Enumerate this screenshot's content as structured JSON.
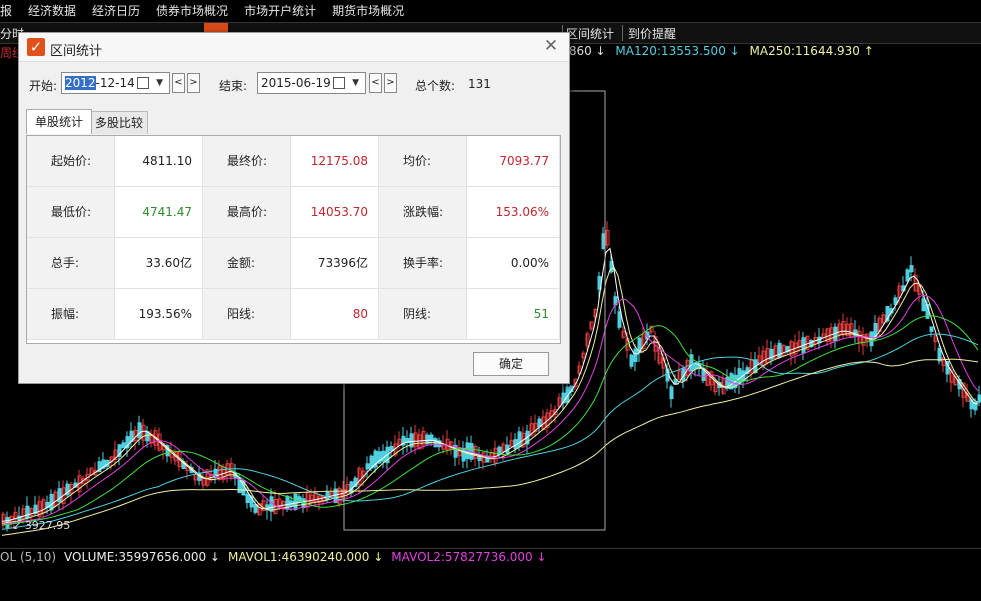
{
  "menubar": [
    "报",
    "经济数据",
    "经济日历",
    "债券市场概况",
    "市场开户统计",
    "期货市场概况"
  ],
  "tabstrip": {
    "left": "分时",
    "middle": "区间统计",
    "right": "到价提醒"
  },
  "side_label": "周线",
  "ma_line": {
    "ma_prefix": ".860 ↓",
    "ma120": "MA120:13553.500 ↓",
    "ma250": "MA250:11644.930 ↑"
  },
  "chart_low_label": "3927.95",
  "volume_line": {
    "prefix": "OL (5,10)",
    "volume": "VOLUME:35997656.000 ↓",
    "mavol1": "MAVOL1:46390240.000 ↓",
    "mavol2": "MAVOL2:57827736.000 ↓"
  },
  "colors": {
    "up": "#e03c3c",
    "down": "#4fd0e0",
    "ma120": "#4fd0e0",
    "ma250": "#f0f0a0",
    "mavol1": "#f0f0a0",
    "mavol2": "#e040e0",
    "dialog_red": "#c0262c",
    "dialog_green": "#2e8b2e",
    "accent": "#e0521a"
  },
  "dialog": {
    "title": "区间统计",
    "icon": "checkmark-icon",
    "start_label": "开始:",
    "start_date_sel": "2012",
    "start_date_rest": "-12-14",
    "end_label": "结束:",
    "end_date": "2015-06-19",
    "prev": "<",
    "next": ">",
    "dropdown": "▼",
    "total_label": "总个数:",
    "total_value": "131",
    "tabs": [
      "单股统计",
      "多股比较"
    ],
    "rows": [
      [
        {
          "k": "起始价:",
          "v": "4811.10",
          "c": "black"
        },
        {
          "k": "最终价:",
          "v": "12175.08",
          "c": "red"
        },
        {
          "k": "均价:",
          "v": "7093.77",
          "c": "red"
        }
      ],
      [
        {
          "k": "最低价:",
          "v": "4741.47",
          "c": "green"
        },
        {
          "k": "最高价:",
          "v": "14053.70",
          "c": "red"
        },
        {
          "k": "涨跌幅:",
          "v": "153.06%",
          "c": "red"
        }
      ],
      [
        {
          "k": "总手:",
          "v": "33.60亿",
          "c": "black"
        },
        {
          "k": "金额:",
          "v": "73396亿",
          "c": "black"
        },
        {
          "k": "换手率:",
          "v": "0.00%",
          "c": "black"
        }
      ],
      [
        {
          "k": "振幅:",
          "v": "193.56%",
          "c": "black"
        },
        {
          "k": "阳线:",
          "v": "80",
          "c": "red"
        },
        {
          "k": "阴线:",
          "v": "51",
          "c": "green"
        }
      ]
    ],
    "ok": "确定"
  }
}
